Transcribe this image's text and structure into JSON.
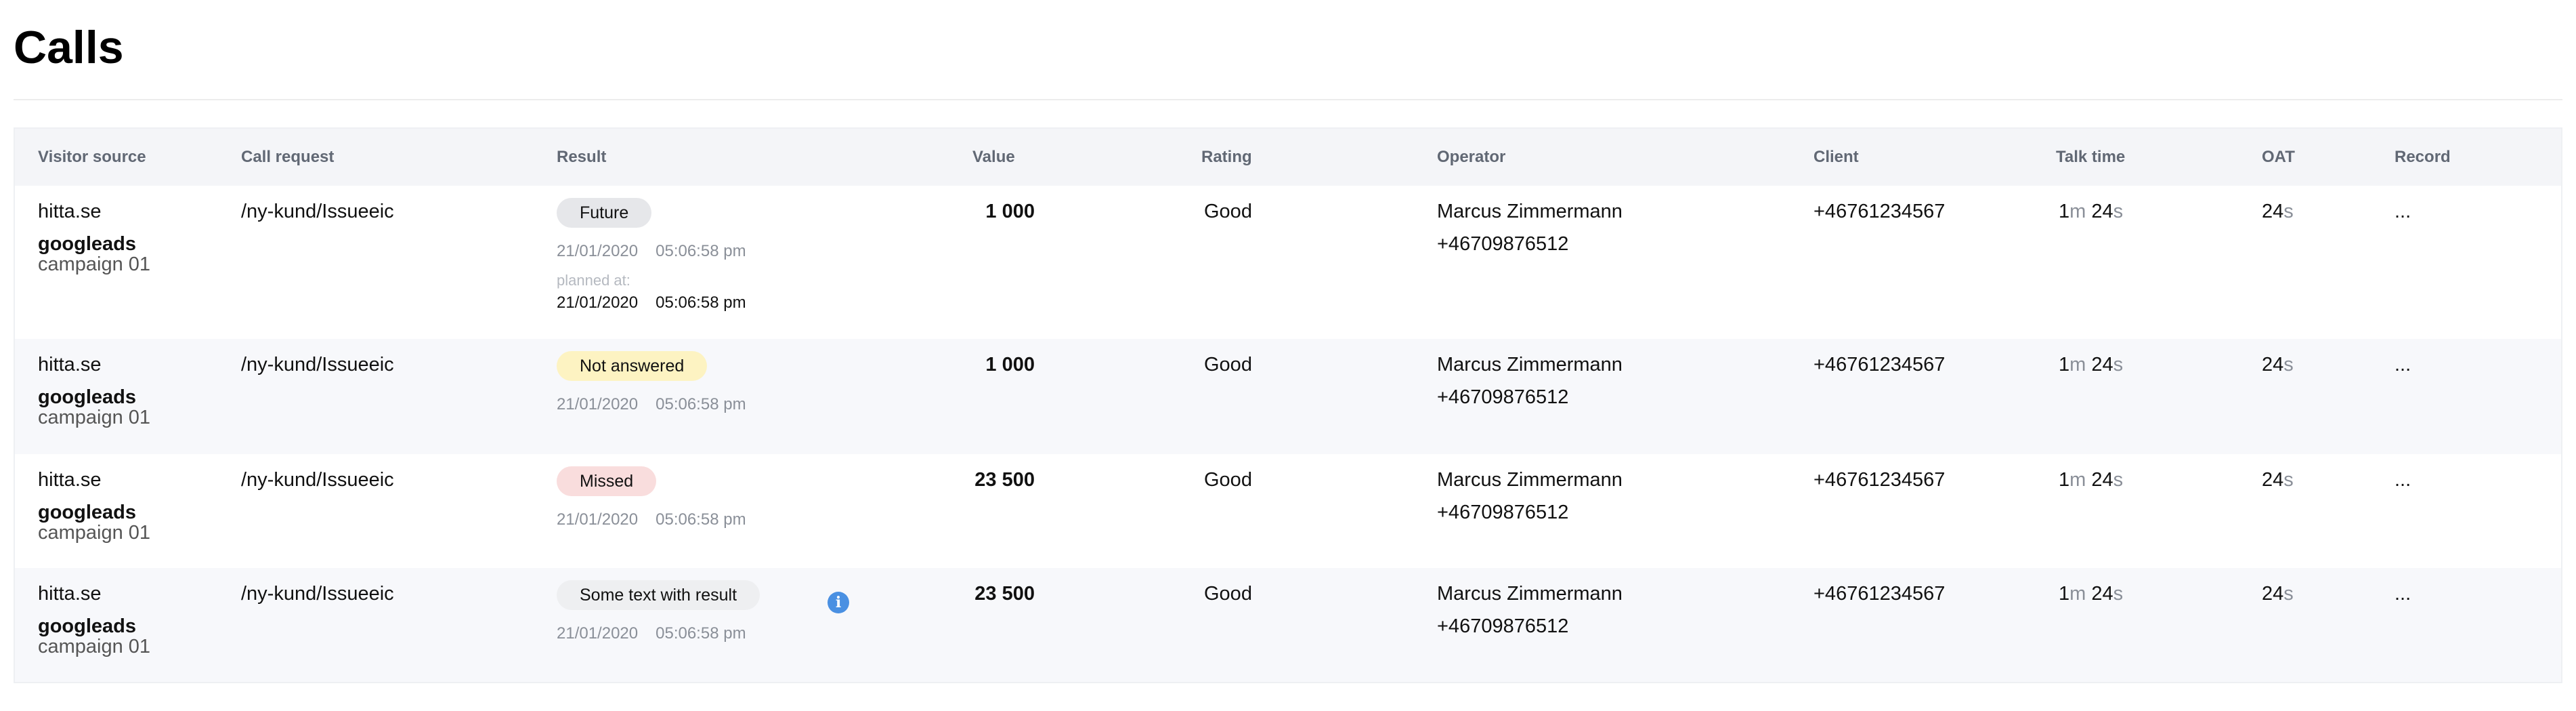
{
  "page": {
    "title": "Calls"
  },
  "table": {
    "headers": {
      "visitor_source": "Visitor source",
      "call_request": "Call request",
      "result": "Result",
      "value": "Value",
      "rating": "Rating",
      "operator": "Operator",
      "client": "Client",
      "talk_time": "Talk time",
      "oat": "OAT",
      "record": "Record"
    },
    "rows": [
      {
        "source": "hitta.se",
        "utm_source": "googleads",
        "campaign": "campaign 01",
        "call_request": "/ny-kund/Issueeic",
        "result_label": "Future",
        "result_status": "future",
        "date": "21/01/2020",
        "time": "05:06:58 pm",
        "planned_label": "planned at:",
        "planned_date": "21/01/2020",
        "planned_time": "05:06:58 pm",
        "value": "1 000",
        "rating": "Good",
        "operator_name": "Marcus Zimmermann",
        "operator_phone": "+46709876512",
        "client": "+46761234567",
        "talk_min": "1",
        "talk_min_unit": "m",
        "talk_sec": "24",
        "talk_sec_unit": "s",
        "oat": "24",
        "oat_unit": "s",
        "record": "..."
      },
      {
        "source": "hitta.se",
        "utm_source": "googleads",
        "campaign": "campaign 01",
        "call_request": "/ny-kund/Issueeic",
        "result_label": "Not answered",
        "result_status": "not-answered",
        "date": "21/01/2020",
        "time": "05:06:58 pm",
        "value": "1 000",
        "rating": "Good",
        "operator_name": "Marcus Zimmermann",
        "operator_phone": "+46709876512",
        "client": "+46761234567",
        "talk_min": "1",
        "talk_min_unit": "m",
        "talk_sec": "24",
        "talk_sec_unit": "s",
        "oat": "24",
        "oat_unit": "s",
        "record": "..."
      },
      {
        "source": "hitta.se",
        "utm_source": "googleads",
        "campaign": "campaign 01",
        "call_request": "/ny-kund/Issueeic",
        "result_label": "Missed",
        "result_status": "missed",
        "date": "21/01/2020",
        "time": "05:06:58 pm",
        "value": "23 500",
        "rating": "Good",
        "operator_name": "Marcus Zimmermann",
        "operator_phone": "+46709876512",
        "client": "+46761234567",
        "talk_min": "1",
        "talk_min_unit": "m",
        "talk_sec": "24",
        "talk_sec_unit": "s",
        "oat": "24",
        "oat_unit": "s",
        "record": "..."
      },
      {
        "source": "hitta.se",
        "utm_source": "googleads",
        "campaign": "campaign 01",
        "call_request": "/ny-kund/Issueeic",
        "result_label": "Some text with result",
        "result_status": "custom",
        "result_info_icon": "info-icon",
        "date": "21/01/2020",
        "time": "05:06:58 pm",
        "value": "23 500",
        "rating": "Good",
        "operator_name": "Marcus Zimmermann",
        "operator_phone": "+46709876512",
        "client": "+46761234567",
        "talk_min": "1",
        "talk_min_unit": "m",
        "talk_sec": "24",
        "talk_sec_unit": "s",
        "oat": "24",
        "oat_unit": "s",
        "record": "..."
      }
    ]
  },
  "colors": {
    "future": "#e6e7ea",
    "not-answered": "#fdf3c2",
    "missed": "#f9dddd",
    "custom": "#eeeff1",
    "info_icon": "#4a90e2"
  }
}
